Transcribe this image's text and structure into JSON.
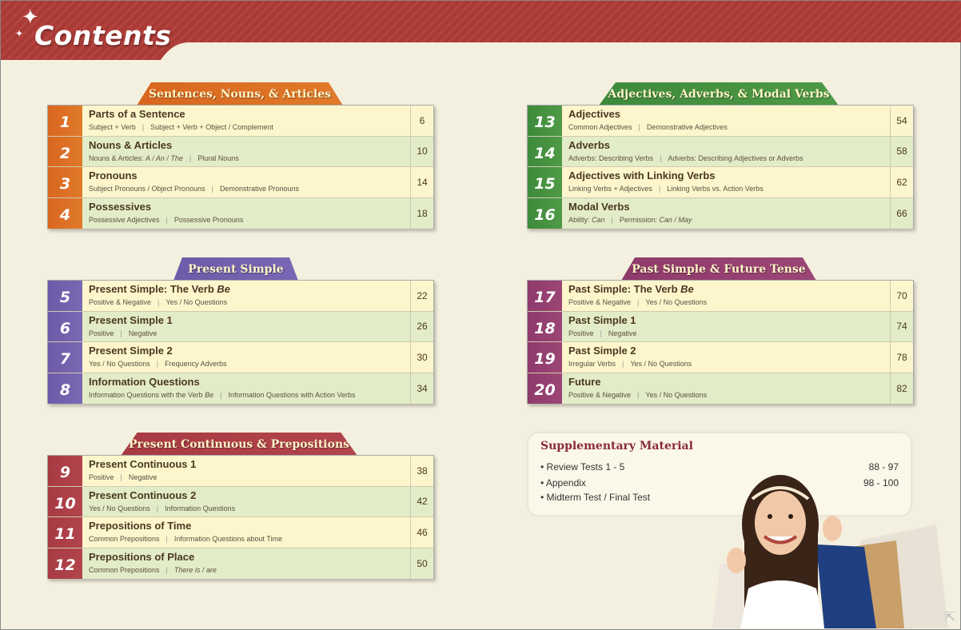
{
  "header": {
    "title": "Contents"
  },
  "colors": {
    "banner": "#a93a36",
    "orange": "#d9661f",
    "purple": "#6d5aa8",
    "red": "#a83a44",
    "green": "#3e8a3c",
    "magenta": "#8e3a6a"
  },
  "sections": [
    {
      "title": "Sentences, Nouns, & Articles",
      "units": [
        {
          "num": "1",
          "title": "Parts of a Sentence",
          "subs": [
            "Subject + Verb",
            "Subject + Verb + Object / Complement"
          ],
          "page": "6"
        },
        {
          "num": "2",
          "title": "Nouns & Articles",
          "subs": [
            "Nouns & Articles: A / An / The",
            "Plural Nouns"
          ],
          "page": "10"
        },
        {
          "num": "3",
          "title": "Pronouns",
          "subs": [
            "Subject Pronouns / Object Pronouns",
            "Demonstrative Pronouns"
          ],
          "page": "14"
        },
        {
          "num": "4",
          "title": "Possessives",
          "subs": [
            "Possessive Adjectives",
            "Possessive Pronouns"
          ],
          "page": "18"
        }
      ]
    },
    {
      "title": "Adjectives, Adverbs, & Modal Verbs",
      "units": [
        {
          "num": "13",
          "title": "Adjectives",
          "subs": [
            "Common Adjectives",
            "Demonstrative Adjectives"
          ],
          "page": "54"
        },
        {
          "num": "14",
          "title": "Adverbs",
          "subs": [
            "Adverbs: Describing Verbs",
            "Adverbs: Describing Adjectives or Adverbs"
          ],
          "page": "58"
        },
        {
          "num": "15",
          "title": "Adjectives with Linking Verbs",
          "subs": [
            "Linking Verbs + Adjectives",
            "Linking Verbs vs. Action Verbs"
          ],
          "page": "62"
        },
        {
          "num": "16",
          "title": "Modal Verbs",
          "subs": [
            "Ability: Can",
            "Permission: Can / May"
          ],
          "page": "66"
        }
      ]
    },
    {
      "title": "Present Simple",
      "units": [
        {
          "num": "5",
          "title": "Present Simple: The Verb Be",
          "subs": [
            "Positive & Negative",
            "Yes / No Questions"
          ],
          "page": "22"
        },
        {
          "num": "6",
          "title": "Present Simple 1",
          "subs": [
            "Positive",
            "Negative"
          ],
          "page": "26"
        },
        {
          "num": "7",
          "title": "Present Simple 2",
          "subs": [
            "Yes / No Questions",
            "Frequency Adverbs"
          ],
          "page": "30"
        },
        {
          "num": "8",
          "title": "Information Questions",
          "subs": [
            "Information Questions with the Verb Be",
            "Information Questions with Action Verbs"
          ],
          "page": "34"
        }
      ]
    },
    {
      "title": "Past Simple & Future Tense",
      "units": [
        {
          "num": "17",
          "title": "Past Simple: The Verb Be",
          "subs": [
            "Positive & Negative",
            "Yes / No Questions"
          ],
          "page": "70"
        },
        {
          "num": "18",
          "title": "Past Simple 1",
          "subs": [
            "Positive",
            "Negative"
          ],
          "page": "74"
        },
        {
          "num": "19",
          "title": "Past Simple 2",
          "subs": [
            "Irregular Verbs",
            "Yes / No Questions"
          ],
          "page": "78"
        },
        {
          "num": "20",
          "title": "Future",
          "subs": [
            "Positive & Negative",
            "Yes / No Questions"
          ],
          "page": "82"
        }
      ]
    },
    {
      "title": "Present Continuous & Prepositions",
      "units": [
        {
          "num": "9",
          "title": "Present Continuous 1",
          "subs": [
            "Positive",
            "Negative"
          ],
          "page": "38"
        },
        {
          "num": "10",
          "title": "Present Continuous 2",
          "subs": [
            "Yes / No Questions",
            "Information Questions"
          ],
          "page": "42"
        },
        {
          "num": "11",
          "title": "Prepositions of Time",
          "subs": [
            "Common Prepositions",
            "Information Questions about Time"
          ],
          "page": "46"
        },
        {
          "num": "12",
          "title": "Prepositions of Place",
          "subs": [
            "Common Prepositions",
            "There is / are"
          ],
          "page": "50"
        }
      ]
    }
  ],
  "supplementary": {
    "title": "Supplementary Material",
    "items": [
      {
        "label": "• Review Tests 1 - 5",
        "pages": "88 - 97"
      },
      {
        "label": "• Appendix",
        "pages": "98 - 100"
      },
      {
        "label": "• Midterm Test / Final Test",
        "pages": ""
      }
    ]
  }
}
